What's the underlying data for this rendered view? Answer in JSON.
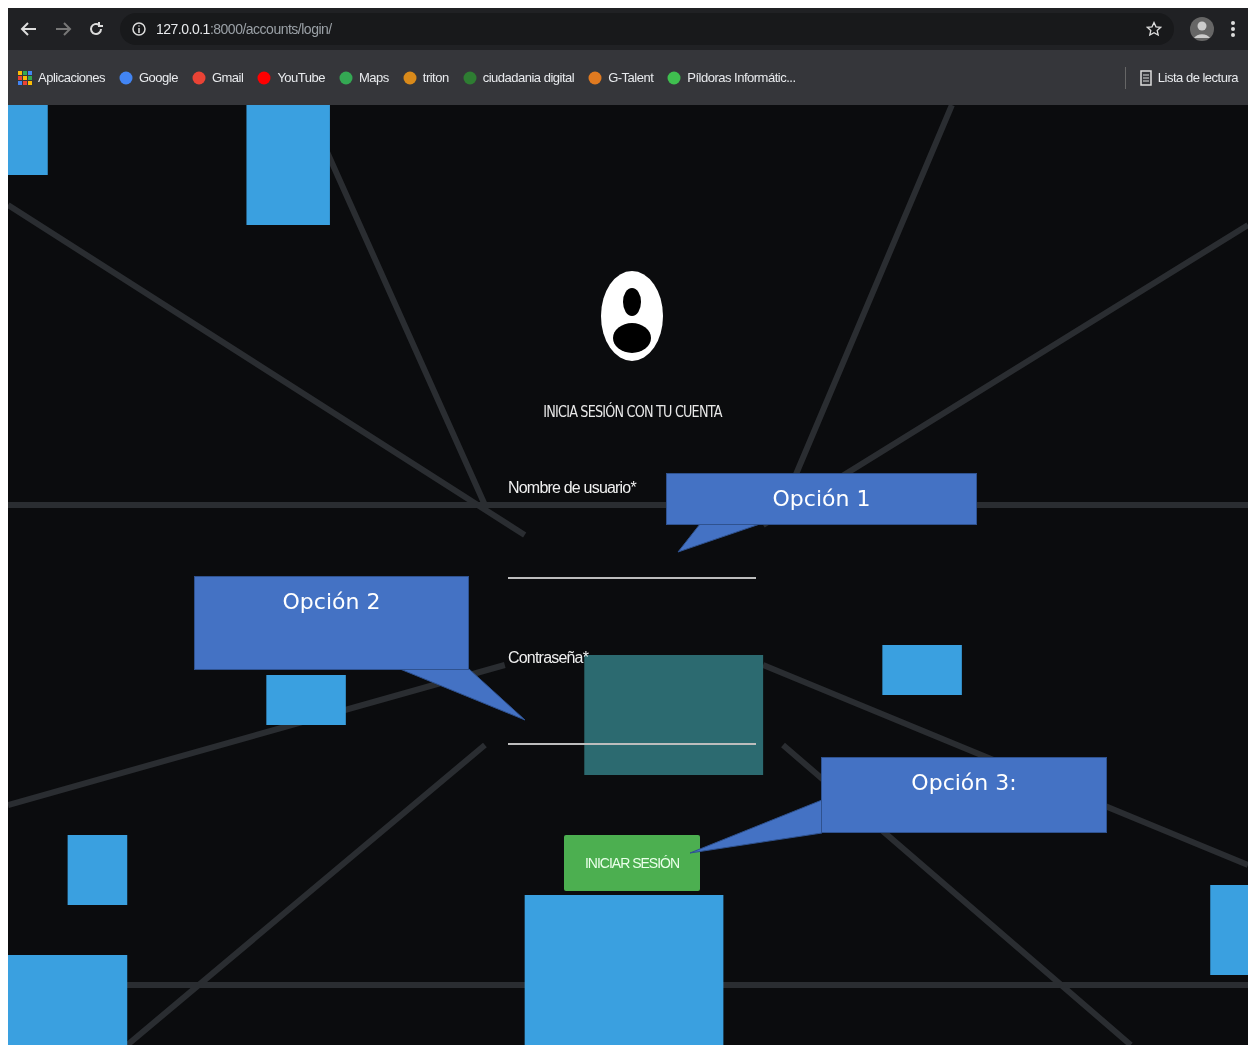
{
  "browser": {
    "url_host": "127.0.0.1",
    "url_path": ":8000/accounts/login/",
    "bookmarks": [
      {
        "label": "Aplicaciones",
        "kind": "apps"
      },
      {
        "label": "Google",
        "kind": "google"
      },
      {
        "label": "Gmail",
        "kind": "gmail"
      },
      {
        "label": "YouTube",
        "kind": "youtube"
      },
      {
        "label": "Maps",
        "kind": "maps"
      },
      {
        "label": "triton",
        "kind": "triton"
      },
      {
        "label": "ciudadania digital",
        "kind": "leaf"
      },
      {
        "label": "G-Talent",
        "kind": "talent"
      },
      {
        "label": "Píldoras Informátic...",
        "kind": "pill"
      }
    ],
    "reading_list": "Lista de lectura"
  },
  "login": {
    "heading": "INICIA SESIÓN CON TU CUENTA",
    "fields": [
      {
        "label": "Nombre de usuario*"
      },
      {
        "label": "Contraseña*"
      }
    ],
    "button": "INICIAR SESIÓN"
  },
  "callouts": [
    {
      "text": "Opción 1"
    },
    {
      "text": "Opción 2"
    },
    {
      "text": "Opción 3:"
    }
  ]
}
